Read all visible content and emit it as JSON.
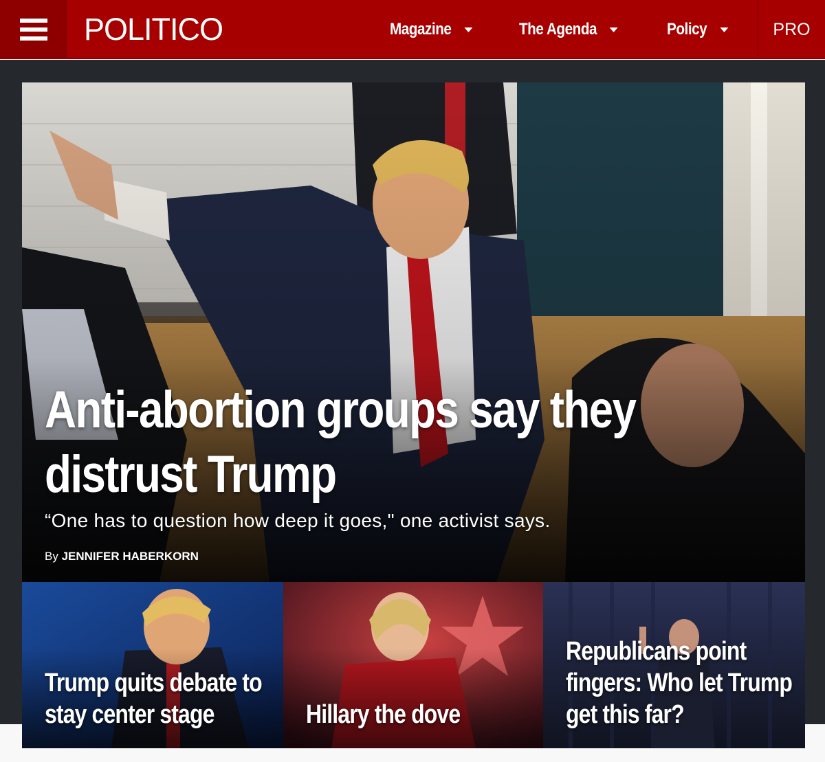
{
  "header": {
    "logo": "POLITICO",
    "nav": [
      {
        "label": "Magazine",
        "has_dropdown": true
      },
      {
        "label": "The Agenda",
        "has_dropdown": true
      },
      {
        "label": "Policy",
        "has_dropdown": true
      }
    ],
    "pro_label": "PRO"
  },
  "hero": {
    "title": "Anti-abortion groups say they distrust Trump",
    "dek": "“One has to question how deep it goes,\" one activist says.",
    "byline_prefix": "By",
    "author": "JENNIFER HABERKORN"
  },
  "cards": [
    {
      "title": "Trump quits debate to stay center stage"
    },
    {
      "title": "Hillary the dove"
    },
    {
      "title": "Republicans point fingers: Who let Trump get this far?"
    }
  ],
  "colors": {
    "brand_red": "#a70000",
    "menu_red": "#8e0000",
    "stage_dark": "#25282c"
  }
}
